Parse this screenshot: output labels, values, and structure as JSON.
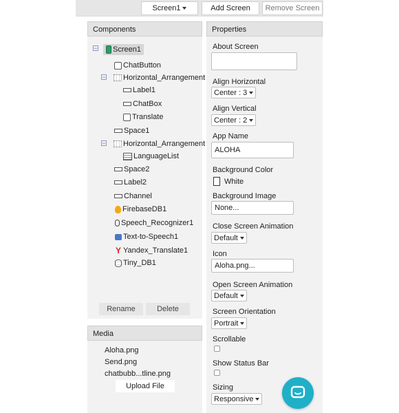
{
  "toolbar": {
    "screen_select": "Screen1",
    "add_screen": "Add Screen",
    "remove_screen": "Remove Screen"
  },
  "components": {
    "title": "Components",
    "tree": {
      "screen1": "Screen1",
      "chat_button": "ChatButton",
      "harr1": "Horizontal_Arrangement",
      "label1": "Label1",
      "chat_box": "ChatBox",
      "translate": "Translate",
      "space1": "Space1",
      "harr2": "Horizontal_Arrangement",
      "language_list": "LanguageList",
      "space2": "Space2",
      "label2": "Label2",
      "channel": "Channel",
      "firebase": "FirebaseDB1",
      "speech": "Speech_Recognizer1",
      "tts": "Text-to-Speech1",
      "yandex": "Yandex_Translate1",
      "tinydb": "Tiny_DB1"
    },
    "rename": "Rename",
    "delete": "Delete"
  },
  "media": {
    "title": "Media",
    "files": [
      "Aloha.png",
      "Send.png",
      "chatbubb...tline.png"
    ],
    "upload": "Upload File"
  },
  "properties": {
    "title": "Properties",
    "about_screen": {
      "label": "About Screen",
      "value": ""
    },
    "align_horizontal": {
      "label": "Align Horizontal",
      "value": "Center : 3"
    },
    "align_vertical": {
      "label": "Align Vertical",
      "value": "Center : 2"
    },
    "app_name": {
      "label": "App Name",
      "value": "ALOHA"
    },
    "background_color": {
      "label": "Background Color",
      "value": "White"
    },
    "background_image": {
      "label": "Background Image",
      "value": "None..."
    },
    "close_screen_animation": {
      "label": "Close Screen Animation",
      "value": "Default"
    },
    "icon": {
      "label": "Icon",
      "value": "Aloha.png..."
    },
    "open_screen_animation": {
      "label": "Open Screen Animation",
      "value": "Default"
    },
    "screen_orientation": {
      "label": "Screen Orientation",
      "value": "Portrait"
    },
    "scrollable": {
      "label": "Scrollable",
      "checked": false
    },
    "show_status_bar": {
      "label": "Show Status Bar",
      "checked": false
    },
    "sizing": {
      "label": "Sizing",
      "value": "Responsive"
    }
  },
  "colors": {
    "panel_bg": "#f2f2f2",
    "header_bg": "#e3e3e3",
    "chat_fab": "#1fb0c8",
    "screen_icon": "#2e9b6b"
  },
  "icons": {
    "chat_fab": "chat-bubble-icon"
  }
}
